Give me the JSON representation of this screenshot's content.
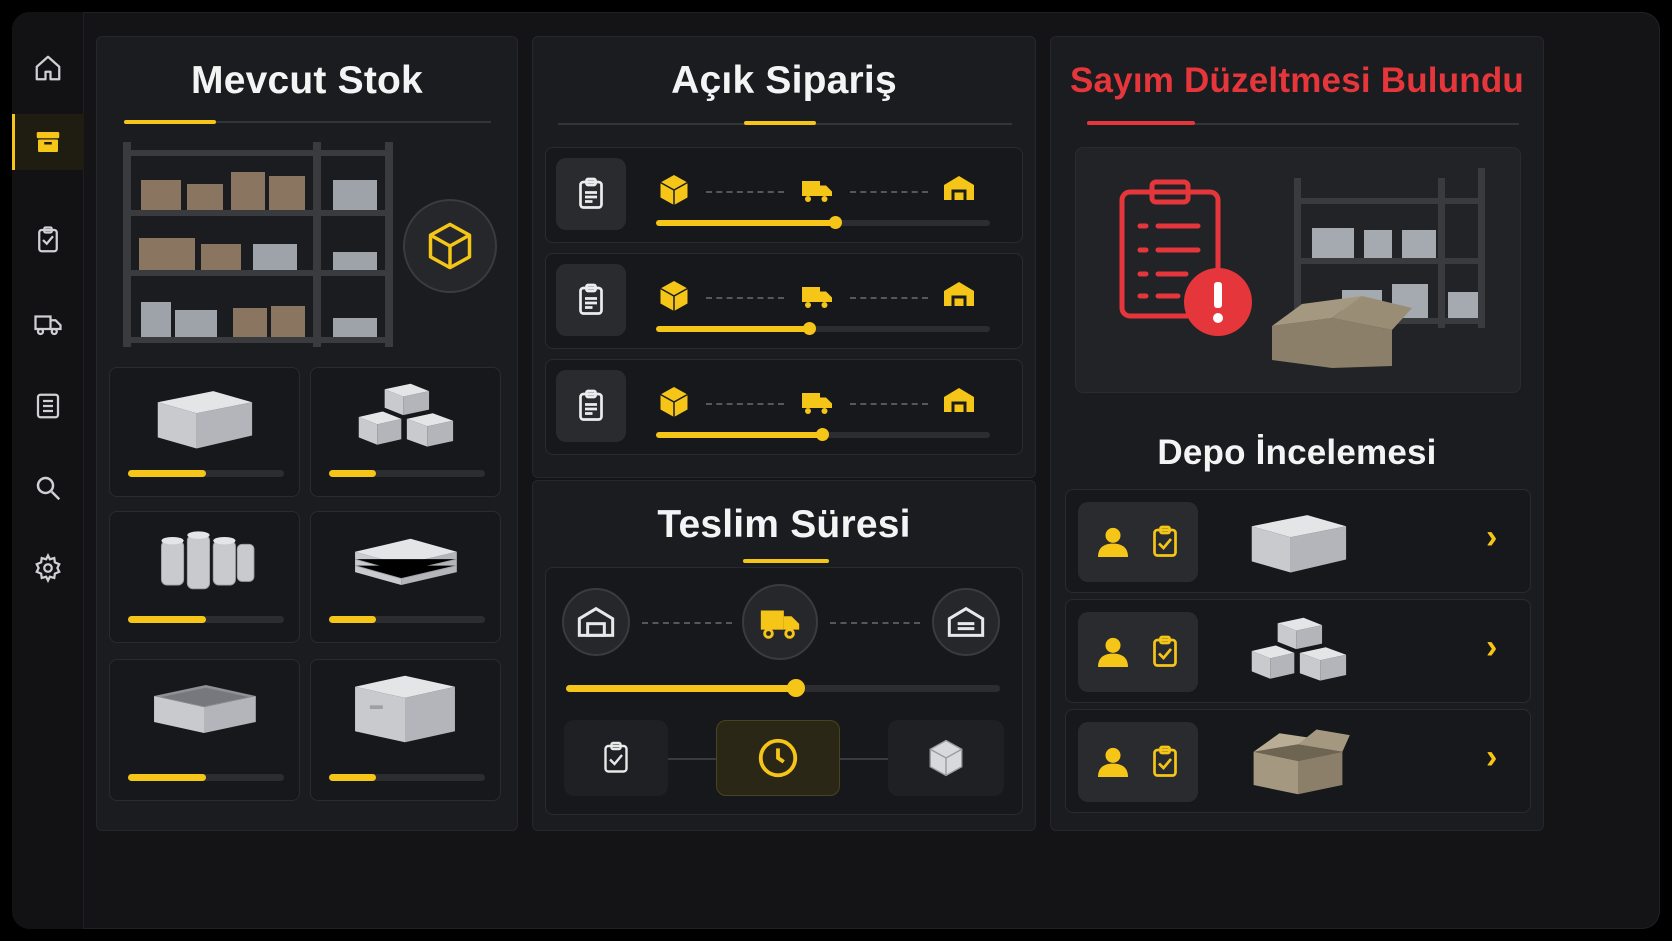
{
  "colors": {
    "accent": "#f5c518",
    "alert": "#e5363b",
    "panel": "#1b1c1f",
    "background": "#141416"
  },
  "sidebar": {
    "items": [
      {
        "icon": "home-icon"
      },
      {
        "icon": "inventory-box-icon",
        "active": true
      },
      {
        "icon": "clipboard-icon"
      },
      {
        "icon": "truck-icon"
      },
      {
        "icon": "list-icon"
      },
      {
        "icon": "search-icon"
      },
      {
        "icon": "settings-gear-icon"
      }
    ]
  },
  "stock": {
    "title": "Mevcut Stok",
    "items": [
      {
        "icon": "closed-box-icon",
        "level": 0.5
      },
      {
        "icon": "stacked-boxes-icon",
        "level": 0.3
      },
      {
        "icon": "canisters-icon",
        "level": 0.5
      },
      {
        "icon": "flat-packs-icon",
        "level": 0.3
      },
      {
        "icon": "open-tray-icon",
        "level": 0.5
      },
      {
        "icon": "large-box-icon",
        "level": 0.3
      }
    ]
  },
  "orders": {
    "title": "Açık Sipariş",
    "rows": [
      {
        "progress": 0.54
      },
      {
        "progress": 0.46
      },
      {
        "progress": 0.5
      }
    ]
  },
  "delivery": {
    "title": "Teslim Süresi",
    "progress": 0.53
  },
  "alert": {
    "title": "Sayım Düzeltmesi Bulundu"
  },
  "review": {
    "title": "Depo İncelemesi",
    "items": [
      {
        "icon": "closed-box-icon"
      },
      {
        "icon": "stacked-boxes-icon"
      },
      {
        "icon": "open-box-icon"
      }
    ]
  }
}
